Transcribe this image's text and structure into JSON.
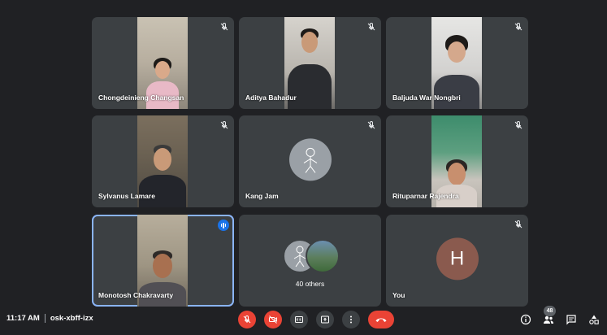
{
  "participants": [
    {
      "name": "Chongdeinieng Changsan",
      "muted": true
    },
    {
      "name": "Aditya Bahadur",
      "muted": true
    },
    {
      "name": "Baljuda War Nongbri",
      "muted": true
    },
    {
      "name": "Sylvanus Lamare",
      "muted": true
    },
    {
      "name": "Kang Jam",
      "muted": true
    },
    {
      "name": "Rituparnar Rajendra",
      "muted": true
    },
    {
      "name": "Monotosh Chakravarty",
      "speaking": true
    },
    {
      "name": "40 others"
    },
    {
      "name": "You",
      "initial": "H",
      "muted": true
    }
  ],
  "meeting": {
    "time": "11:17 AM",
    "code": "osk-xbff-izx"
  },
  "toolbar": {
    "people_count": "48",
    "icons": [
      "mic-off-icon",
      "camera-off-icon",
      "captions-icon",
      "present-icon",
      "more-icon",
      "end-call-icon"
    ]
  },
  "colors": {
    "background": "#202124",
    "tile": "#3c4043",
    "danger": "#ea4335",
    "active": "#1a73e8",
    "avatar_you": "#8a5a4e"
  }
}
